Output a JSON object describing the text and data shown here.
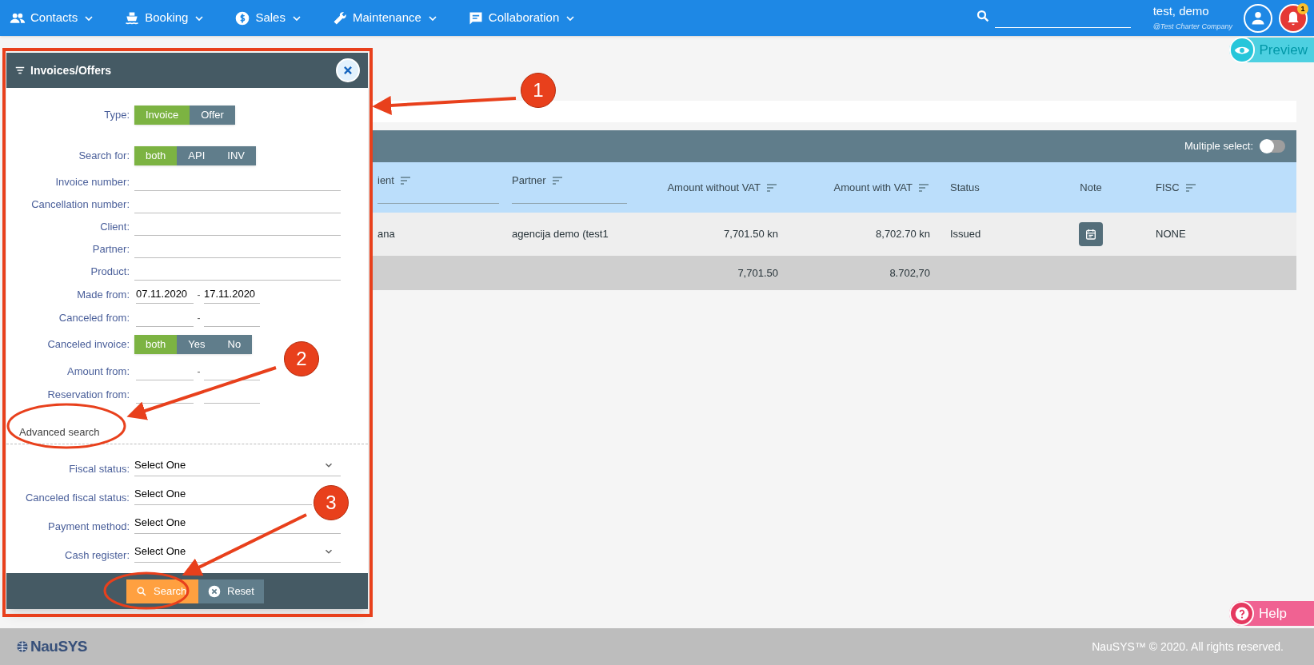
{
  "nav": {
    "menus": [
      {
        "label": "Contacts"
      },
      {
        "label": "Booking"
      },
      {
        "label": "Sales"
      },
      {
        "label": "Maintenance"
      },
      {
        "label": "Collaboration"
      }
    ],
    "user": {
      "name": "test, demo",
      "company": "@Test Charter Company"
    },
    "notification_count": "1"
  },
  "preview_tab": "Preview",
  "filter_panel": {
    "title": "Invoices/Offers",
    "fields": [
      {
        "kind": "toggle",
        "label": "Type:",
        "options": [
          {
            "label": "Invoice",
            "selected": true
          },
          {
            "label": "Offer",
            "selected": false
          }
        ]
      },
      {
        "kind": "toggle",
        "label": "Search for:",
        "options": [
          {
            "label": "both",
            "selected": true
          },
          {
            "label": "API",
            "selected": false
          },
          {
            "label": "INV",
            "selected": false
          }
        ]
      },
      {
        "kind": "text",
        "label": "Invoice number:"
      },
      {
        "kind": "text",
        "label": "Cancellation number:"
      },
      {
        "kind": "text",
        "label": "Client:"
      },
      {
        "kind": "text",
        "label": "Partner:"
      },
      {
        "kind": "text",
        "label": "Product:"
      },
      {
        "kind": "range",
        "label": "Made from:",
        "from": "07.11.2020",
        "separator": "-",
        "to": "17.11.2020"
      },
      {
        "kind": "range",
        "label": "Canceled from:",
        "separator": "-"
      },
      {
        "kind": "toggle",
        "label": "Canceled invoice:",
        "options": [
          {
            "label": "both",
            "selected": true
          },
          {
            "label": "Yes",
            "selected": false
          },
          {
            "label": "No",
            "selected": false
          }
        ]
      },
      {
        "kind": "range",
        "label": "Amount from:",
        "separator": "-"
      },
      {
        "kind": "range",
        "label": "Reservation from:"
      }
    ],
    "advanced_label": "Advanced search",
    "advanced_fields": [
      {
        "label": "Fiscal status:",
        "value": "Select One",
        "chevron": true
      },
      {
        "label": "Canceled fiscal status:",
        "value": "Select One"
      },
      {
        "label": "Payment method:",
        "value": "Select One"
      },
      {
        "label": "Cash register:",
        "value": "Select One",
        "chevron": true
      }
    ],
    "buttons": [
      {
        "kind": "primary",
        "label": "Search"
      },
      {
        "kind": "secondary",
        "label": "Reset"
      }
    ]
  },
  "table": {
    "multiple_select": {
      "label": "Multiple select:",
      "on": false
    },
    "columns": [
      {
        "label": "ient",
        "sortable": true,
        "filter": true
      },
      {
        "label": "Partner",
        "sortable": true,
        "filter": true
      },
      {
        "label": "Amount without VAT",
        "sortable": true,
        "filter": false
      },
      {
        "label": "Amount with VAT",
        "sortable": true,
        "filter": false
      },
      {
        "label": "Status",
        "sortable": false,
        "filter": false
      },
      {
        "label": "Note",
        "sortable": false,
        "filter": false
      },
      {
        "label": "FISC",
        "sortable": true,
        "filter": false
      }
    ],
    "rows": [
      {
        "cells": [
          {
            "text": "ana"
          },
          {
            "text": "agencija demo (test1"
          },
          {
            "text": "7,701.50 kn"
          },
          {
            "text": "8,702.70 kn"
          },
          {
            "text": "Issued"
          },
          {
            "kind": "note"
          },
          {
            "text": "NONE"
          }
        ]
      }
    ],
    "totals": {
      "amount_without_vat": "7,701.50",
      "amount_with_vat": "8.702,70"
    }
  },
  "help_tab": "Help",
  "footer": {
    "logo": "NauSYS",
    "copyright": "NauSYS™ © 2020. All rights reserved."
  },
  "annotations": [
    {
      "number": "1"
    },
    {
      "number": "2"
    },
    {
      "number": "3"
    }
  ]
}
